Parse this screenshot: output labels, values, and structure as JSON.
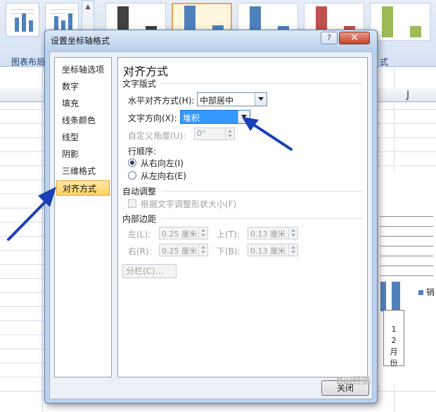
{
  "ribbon": {
    "group_label_left": "图表布局",
    "group_label_right": "式",
    "scroll_glyph": "▲"
  },
  "sheet": {
    "column_j": "J",
    "legend_text": "销",
    "axis_label_lines": [
      "1",
      "2",
      "月",
      "份"
    ]
  },
  "dialog": {
    "title": "设置坐标轴格式",
    "help_label": "?",
    "close_glyph": "✕",
    "nav_items": [
      {
        "label": "坐标轴选项"
      },
      {
        "label": "数字"
      },
      {
        "label": "填充"
      },
      {
        "label": "线条颜色"
      },
      {
        "label": "线型"
      },
      {
        "label": "阴影"
      },
      {
        "label": "三维格式"
      },
      {
        "label": "对齐方式",
        "active": true
      }
    ],
    "panel": {
      "title": "对齐方式",
      "text_layout": {
        "section_label": "文字版式",
        "horizontal_align_label": "水平对齐方式(H):",
        "horizontal_align_value": "中部居中",
        "text_direction_label": "文字方向(X):",
        "text_direction_value": "堆积",
        "custom_angle_label": "自定义角度(U):",
        "custom_angle_value": "0°",
        "row_order_label": "行顺序:",
        "rtl_label": "从右向左(I)",
        "ltr_label": "从左向右(E)",
        "row_order_selected": "rtl"
      },
      "autofit": {
        "section_label": "自动调整",
        "resize_shape_label": "根据文字调整形状大小(F)",
        "resize_shape_checked": false
      },
      "internal_margin": {
        "section_label": "内部边距",
        "left_label": "左(L):",
        "left_value": "0.25 厘米",
        "top_label": "上(T):",
        "top_value": "0.13 厘米",
        "right_label": "右(R):",
        "right_value": "0.25 厘米",
        "bottom_label": "下(B):",
        "bottom_value": "0.13 厘米",
        "columns_button": "分栏(C)..."
      }
    },
    "close_button": "关闭"
  },
  "watermark": "Bai经验",
  "colors": {
    "accent_blue": "#3399ff",
    "nav_active": "#ffd160",
    "arrow_blue": "#1a3fb8"
  }
}
